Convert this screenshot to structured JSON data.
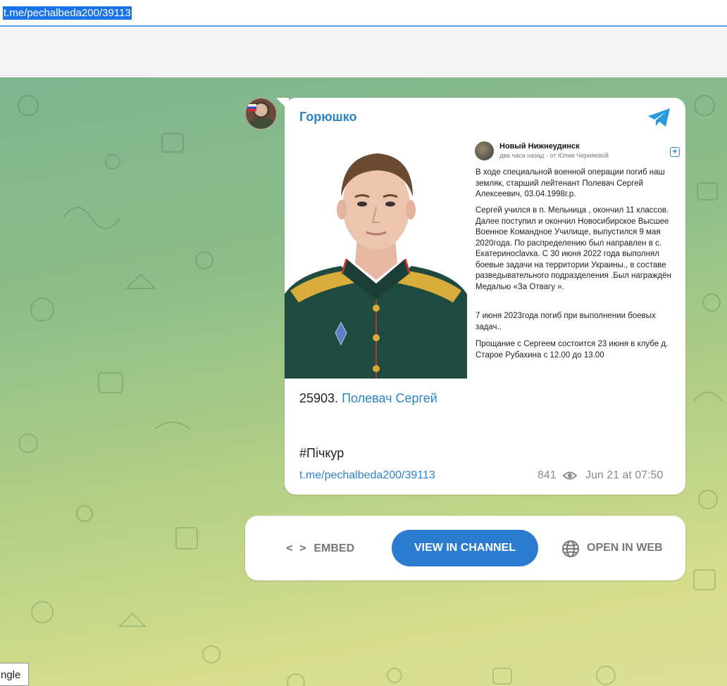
{
  "address_bar": {
    "url": "t.me/pechalbeda200/39113"
  },
  "post": {
    "channel_name": "Горюшко",
    "inner": {
      "author": "Новый Нижнеудинск",
      "meta": "два часа назад · от Юлии Черняевой",
      "plus": "+",
      "paragraphs": [
        "В ходе специальной военной операции погиб наш земляк, старший лейтенант Полевач Сергей Алексеевич, 03.04.1998г.р.",
        "Сергей учился в п. Мельница , окончил 11 классов. Далее поступил и окончил Новосибирское Высшее  Военное Командное Училище, выпустился 9 мая 2020года. По распределению был направлен в с. Екатериносlavка. С 30 июня 2022 года выполнял боевые задачи на территории Украины., в составе разведывательного подразделения .Был награждён Медалью «За Отвагу ».",
        "7 июня 2023года погиб при выполнении боевых задач..",
        "Прощание с Сергеем состоится 23 июня в клубе д. Старое Рубахина с 12.00 до 13.00"
      ]
    },
    "number": "25903.",
    "name_link": "Полевач Сергей",
    "hashtag": "#Пічкур",
    "link": "t.me/pechalbeda200/39113",
    "views": "841",
    "date": "Jun 21 at 07:50"
  },
  "actions": {
    "embed_icon": "< >",
    "embed_label": "EMBED",
    "view_label": "VIEW IN CHANNEL",
    "web_label": "OPEN IN WEB"
  },
  "tooltip": {
    "text": "ngle"
  },
  "colors": {
    "accent": "#2b84c8",
    "button": "#2b7bd0"
  }
}
